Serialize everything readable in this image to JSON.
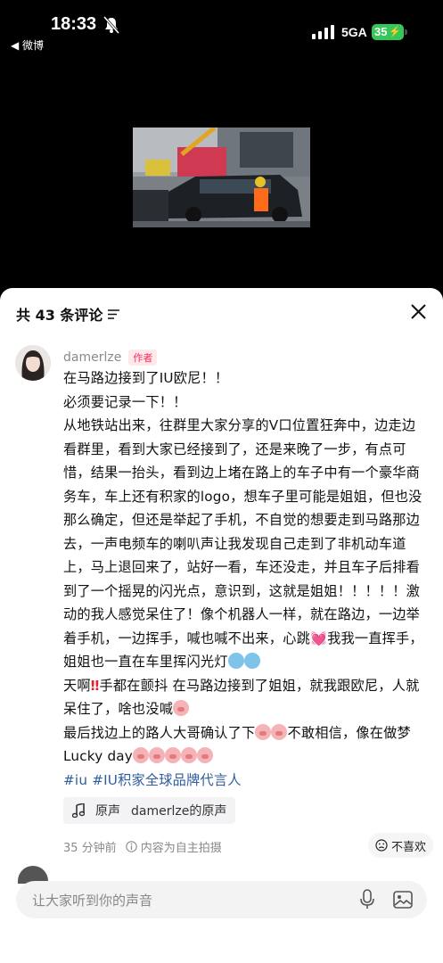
{
  "status_bar": {
    "time": "18:33",
    "back_app": "◀ 微博",
    "network": "5GA",
    "battery": "35"
  },
  "video": {
    "icon": "video-thumbnail"
  },
  "sheet": {
    "title": "共 43 条评论",
    "comment": {
      "author": "damerlze",
      "author_tag": "作者",
      "body_parts": {
        "p1": "在马路边接到了IU欧尼！！",
        "p2": "必须要记录一下！！",
        "p3": "从地铁站出来，往群里大家分享的V口位置狂奔中，边走边看群里，看到大家已经接到了，还是来晚了一步，有点可惜，结果一抬头，看到边上堵在路上的车子中有一个豪华商务车，车上还有积家的logo，想车子里可能是姐姐，但也没那么确定，但还是举起了手机，不自觉的想要走到马路那边去，一声电频车的喇叭声让我发现自己走到了非机动车道上，马上退回来了，站好一看，车还没走，并且车子后排看到了一个摇晃的闪光点，意识到，这就是姐姐！！！！！激动的我人感觉呆住了！像个机器人一样，就在路边，一边举着手机，一边挥手，喊也喊不出来，心跳",
        "p3b": "我我一直挥手，姐姐也一直在车里挥闪光灯",
        "p4a": "天啊",
        "p4b": "手都在颤抖 在马路边接到了姐姐，就我跟欧尼，人就呆住了，啥也没喊",
        "p5a": "最后找边上的路人大哥确认了下",
        "p5b": "不敢相信，像在做梦",
        "p6": "Lucky day"
      },
      "hashtags": "#iu #IU积家全球品牌代言人",
      "sound_label": "原声",
      "sound_name": "damerlze的原声",
      "time_ago": "35 分钟前",
      "disclaimer": "内容为自主拍摄",
      "dislike_label": "不喜欢"
    },
    "input_placeholder": "让大家听到你的声音"
  },
  "colors": {
    "accent_tag": "#fe2c55",
    "hashtag": "#2f5e9e",
    "battery": "#34c759"
  }
}
